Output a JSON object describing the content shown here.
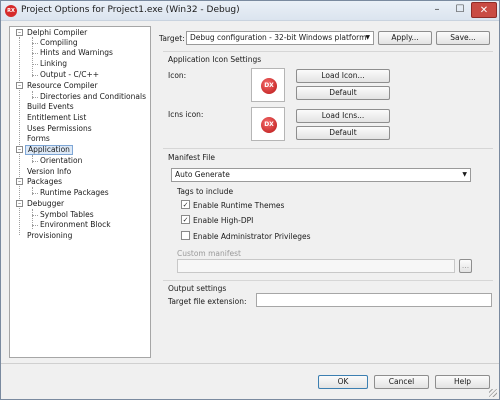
{
  "window": {
    "title": "Project Options for Project1.exe  (Win32 - Debug)",
    "app_icon_text": "RX",
    "minimize": "–",
    "maximize": "☐",
    "close": "✕"
  },
  "tree": {
    "items": [
      {
        "label": "Delphi Compiler",
        "toggle": "–"
      },
      {
        "label": "Compiling"
      },
      {
        "label": "Hints and Warnings"
      },
      {
        "label": "Linking"
      },
      {
        "label": "Output - C/C++"
      },
      {
        "label": "Resource Compiler",
        "toggle": "–"
      },
      {
        "label": "Directories and Conditionals"
      },
      {
        "label": "Build Events"
      },
      {
        "label": "Entitlement List"
      },
      {
        "label": "Uses Permissions"
      },
      {
        "label": "Forms"
      },
      {
        "label": "Application",
        "toggle": "–"
      },
      {
        "label": "Orientation"
      },
      {
        "label": "Version Info"
      },
      {
        "label": "Packages",
        "toggle": "–"
      },
      {
        "label": "Runtime Packages"
      },
      {
        "label": "Debugger",
        "toggle": "–"
      },
      {
        "label": "Symbol Tables"
      },
      {
        "label": "Environment Block"
      },
      {
        "label": "Provisioning"
      }
    ]
  },
  "target": {
    "label": "Target:",
    "value": "Debug configuration - 32-bit Windows platform",
    "apply": "Apply...",
    "save": "Save..."
  },
  "icon_settings": {
    "title": "Application Icon Settings",
    "icon_label": "Icon:",
    "icns_label": "Icns icon:",
    "icon_text": "DX",
    "load_icon": "Load Icon...",
    "default1": "Default",
    "load_icns": "Load Icns...",
    "default2": "Default"
  },
  "manifest": {
    "title": "Manifest File",
    "mode": "Auto Generate",
    "tags_title": "Tags to include",
    "runtime_themes": "Enable Runtime Themes",
    "high_dpi": "Enable High-DPI",
    "admin": "Enable Administrator Privileges",
    "check": "✓",
    "custom_label": "Custom manifest",
    "browse": "..."
  },
  "output": {
    "title": "Output settings",
    "ext_label": "Target file extension:"
  },
  "footer": {
    "ok": "OK",
    "cancel": "Cancel",
    "help": "Help"
  },
  "colors": {
    "accent": "#3c7fb1",
    "close_button": "#c94b43",
    "selection": "#dde9f7"
  }
}
